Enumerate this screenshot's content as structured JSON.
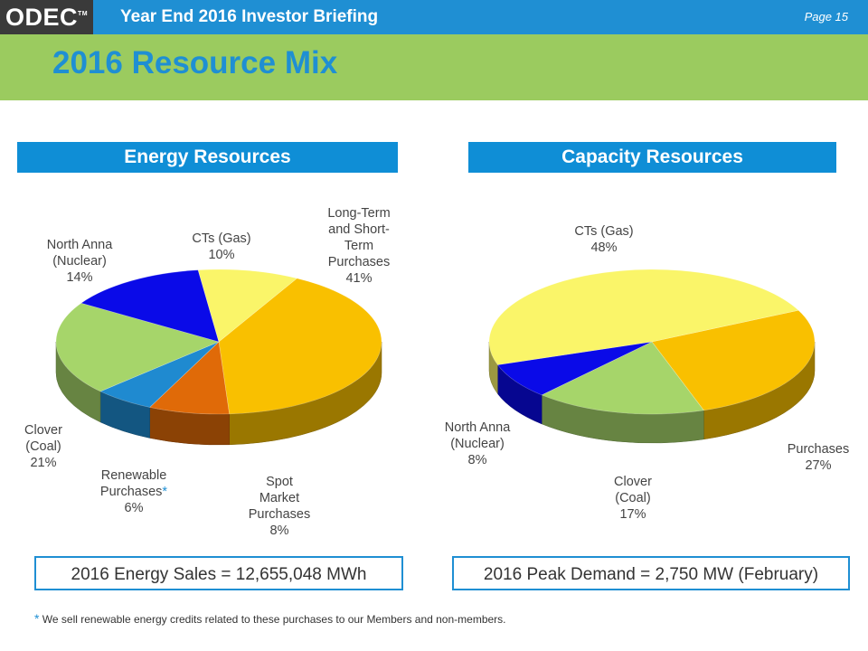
{
  "header": {
    "logo": "ODEC",
    "logo_tm": "TM",
    "briefing": "Year End 2016 Investor Briefing",
    "page": "Page 15"
  },
  "slide_title": "2016 Resource Mix",
  "sections": {
    "energy": {
      "heading": "Energy Resources",
      "total": "2016 Energy Sales = 12,655,048 MWh"
    },
    "capacity": {
      "heading": "Capacity Resources",
      "total": "2016 Peak Demand = 2,750 MW (February)"
    }
  },
  "footnote": {
    "star": "*",
    "text": "We sell renewable energy credits related to these purchases to our Members and non-members."
  },
  "chart_data": [
    {
      "type": "pie",
      "title": "Energy Resources",
      "categories": [
        "Long-Term and Short-Term Purchases",
        "Spot Market Purchases",
        "Renewable Purchases*",
        "Clover (Coal)",
        "North Anna (Nuclear)",
        "CTs (Gas)"
      ],
      "values": [
        41,
        8,
        6,
        21,
        14,
        10
      ],
      "unit": "%",
      "labels": [
        {
          "lines": [
            "Long-Term",
            "and Short-",
            "Term",
            "Purchases"
          ],
          "pct": "41%"
        },
        {
          "lines": [
            "Spot",
            "Market",
            "Purchases"
          ],
          "pct": "8%"
        },
        {
          "lines": [
            "Renewable",
            "Purchases"
          ],
          "star": "*",
          "pct": "6%"
        },
        {
          "lines": [
            "Clover",
            "(Coal)"
          ],
          "pct": "21%"
        },
        {
          "lines": [
            "North Anna",
            "(Nuclear)"
          ],
          "pct": "14%"
        },
        {
          "lines": [
            "CTs (Gas)"
          ],
          "pct": "10%"
        }
      ],
      "colors": [
        "#f9c000",
        "#e06a08",
        "#1f8ad0",
        "#a6d56a",
        "#0a0ae8",
        "#faf569"
      ],
      "style": "3d"
    },
    {
      "type": "pie",
      "title": "Capacity Resources",
      "categories": [
        "Purchases",
        "Clover (Coal)",
        "North Anna (Nuclear)",
        "CTs (Gas)"
      ],
      "values": [
        27,
        17,
        8,
        48
      ],
      "unit": "%",
      "labels": [
        {
          "lines": [
            "Purchases"
          ],
          "pct": "27%"
        },
        {
          "lines": [
            "Clover",
            "(Coal)"
          ],
          "pct": "17%"
        },
        {
          "lines": [
            "North Anna",
            "(Nuclear)"
          ],
          "pct": "8%"
        },
        {
          "lines": [
            "CTs (Gas)"
          ],
          "pct": "48%"
        }
      ],
      "colors": [
        "#f9c000",
        "#a6d56a",
        "#0a0ae8",
        "#faf569"
      ],
      "style": "3d"
    }
  ]
}
